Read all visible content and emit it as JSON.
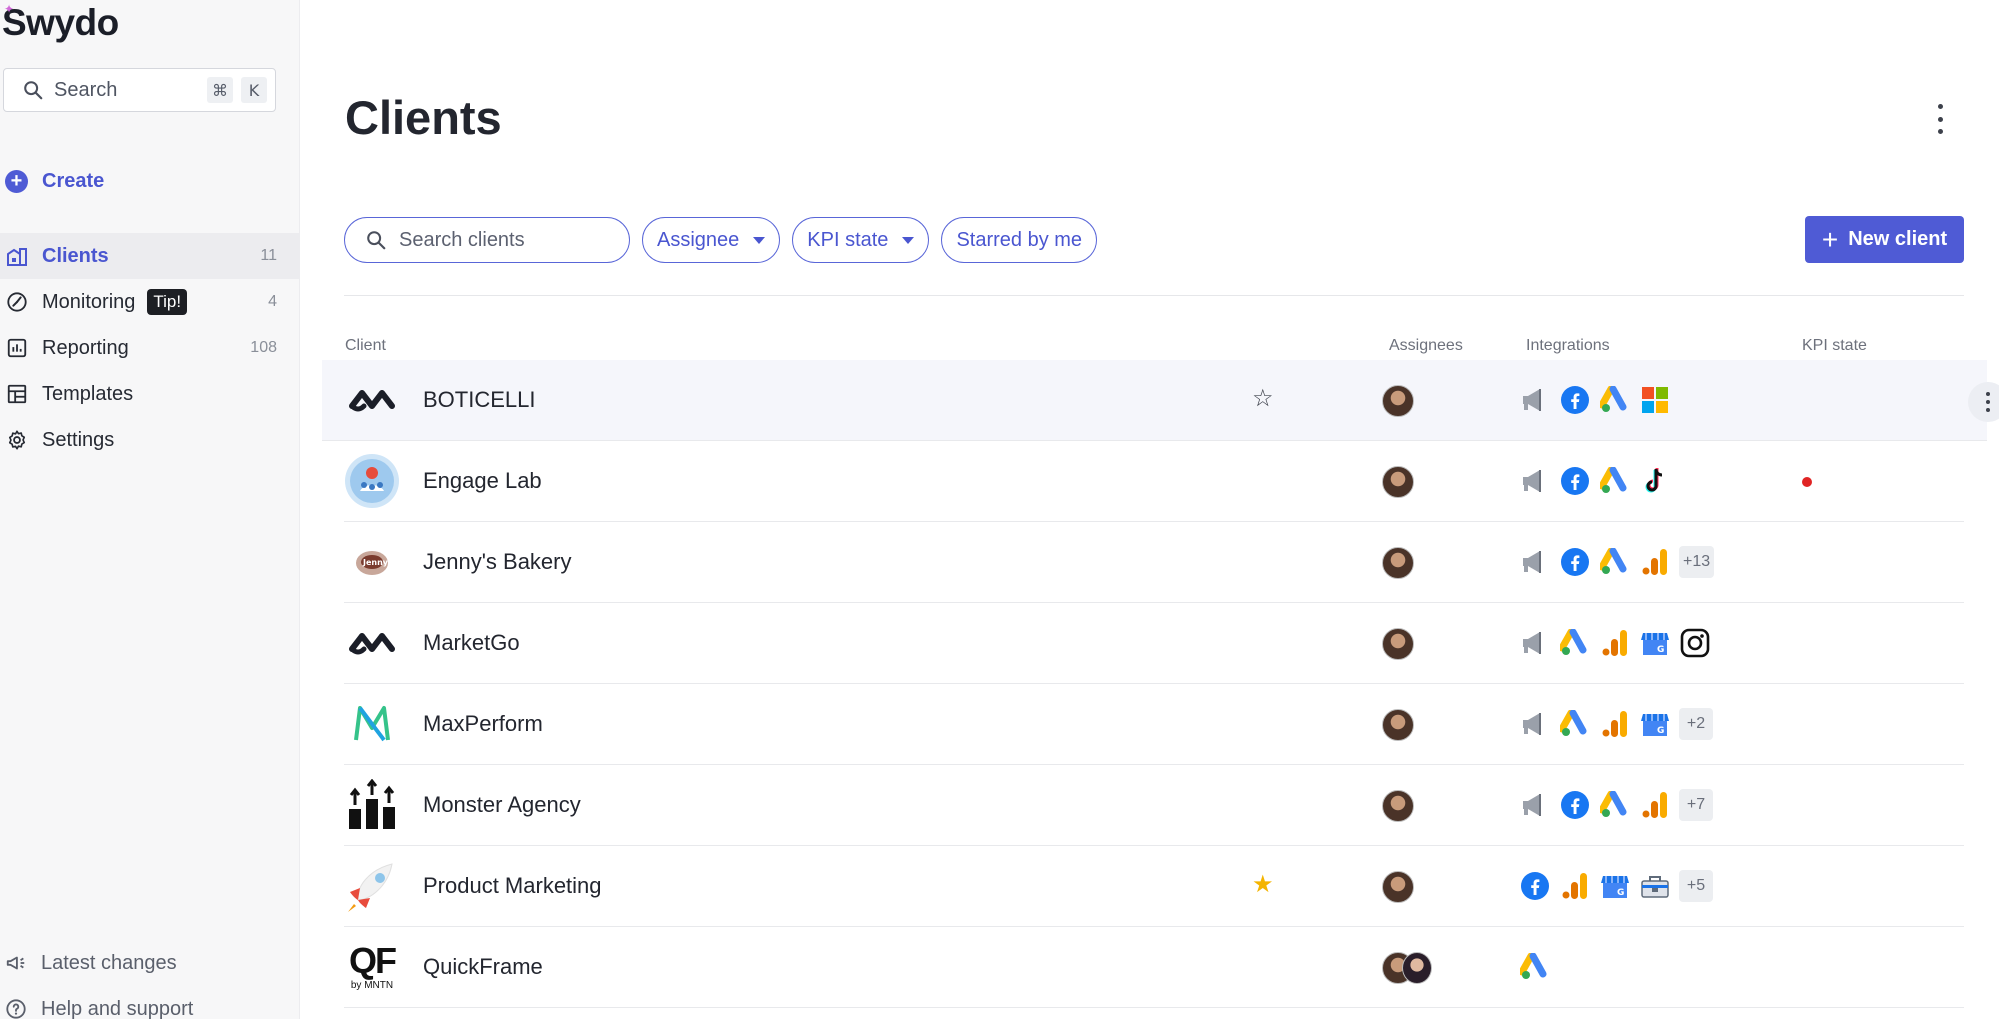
{
  "app": {
    "logo_text": "Swydo"
  },
  "sidebar": {
    "search": {
      "label": "Search",
      "shortcut_mod": "⌘",
      "shortcut_key": "K"
    },
    "create_label": "Create",
    "items": [
      {
        "label": "Clients",
        "count": "11",
        "icon": "clients-building-icon",
        "active": true
      },
      {
        "label": "Monitoring",
        "count": "4",
        "icon": "monitoring-gauge-icon",
        "badge": "Tip!"
      },
      {
        "label": "Reporting",
        "count": "108",
        "icon": "reporting-chart-icon"
      },
      {
        "label": "Templates",
        "count": "",
        "icon": "templates-layout-icon"
      },
      {
        "label": "Settings",
        "count": "",
        "icon": "settings-gear-icon"
      }
    ],
    "bottom": [
      {
        "label": "Latest changes",
        "icon": "megaphone-icon"
      },
      {
        "label": "Help and support",
        "icon": "help-circle-icon"
      }
    ]
  },
  "main": {
    "title": "Clients",
    "search_placeholder": "Search clients",
    "filters": [
      "Assignee",
      "KPI state",
      "Starred by me"
    ],
    "new_client_label": "New client",
    "columns": {
      "client": "Client",
      "assignees": "Assignees",
      "integrations": "Integrations",
      "kpi": "KPI state"
    },
    "rows": [
      {
        "name": "BOTICELLI",
        "logo": "infinity-logo",
        "starred": false,
        "star_visible": true,
        "integrations": [
          "megaphone",
          "facebook",
          "google-ads",
          "microsoft"
        ],
        "more": "",
        "kpi_alert": false,
        "hover": true
      },
      {
        "name": "Engage Lab",
        "logo": "engage-lab-logo",
        "starred": false,
        "star_visible": false,
        "integrations": [
          "megaphone",
          "facebook",
          "google-ads",
          "tiktok"
        ],
        "more": "",
        "kpi_alert": true
      },
      {
        "name": "Jenny's Bakery",
        "logo": "bakery-logo",
        "starred": false,
        "star_visible": false,
        "integrations": [
          "megaphone",
          "facebook",
          "google-ads",
          "analytics"
        ],
        "more": "+13",
        "kpi_alert": false
      },
      {
        "name": "MarketGo",
        "logo": "infinity-logo",
        "starred": false,
        "star_visible": false,
        "integrations": [
          "megaphone",
          "google-ads",
          "analytics",
          "business-profile",
          "instagram"
        ],
        "more": "",
        "kpi_alert": false
      },
      {
        "name": "MaxPerform",
        "logo": "maxperform-logo",
        "starred": false,
        "star_visible": false,
        "integrations": [
          "megaphone",
          "google-ads",
          "analytics",
          "business-profile"
        ],
        "more": "+2",
        "kpi_alert": false
      },
      {
        "name": "Monster Agency",
        "logo": "monster-logo",
        "starred": false,
        "star_visible": false,
        "integrations": [
          "megaphone",
          "facebook",
          "google-ads",
          "analytics"
        ],
        "more": "+7",
        "kpi_alert": false
      },
      {
        "name": "Product Marketing",
        "logo": "rocket-logo",
        "starred": true,
        "star_visible": true,
        "integrations": [
          "facebook",
          "analytics",
          "business-profile",
          "toolbox"
        ],
        "more": "+5",
        "kpi_alert": false
      },
      {
        "name": "QuickFrame",
        "logo": "quickframe-logo",
        "logo_text": "QF",
        "logo_subtext": "by MNTN",
        "starred": false,
        "star_visible": false,
        "integrations": [
          "google-ads"
        ],
        "more": "",
        "kpi_alert": false,
        "two_assignees": true
      }
    ]
  },
  "colors": {
    "accent": "#4f5bd5",
    "kpi_alert": "#e02424",
    "star": "#f4b400"
  }
}
